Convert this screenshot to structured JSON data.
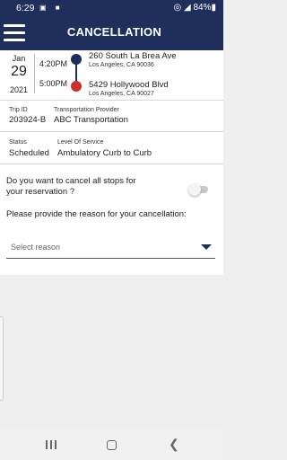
{
  "status_bar": {
    "time": "6:29",
    "notification_icons": "▣ ■",
    "right": "◎ ◢ 84%▮"
  },
  "header": {
    "title": "CANCELLATION"
  },
  "trip": {
    "month": "Jan",
    "day": "29",
    "year": "2021",
    "pickup_time": "4:20PM",
    "dropoff_time": "5:00PM",
    "pickup_address": "260 South La Brea Ave",
    "pickup_city": "Los Angeles, CA 90036",
    "dropoff_address": "5429 Hollywood Blvd",
    "dropoff_city": "Los Angeles, CA 90027"
  },
  "details": {
    "trip_id_label": "Trip ID",
    "trip_id": "203924-B",
    "provider_label": "Transportation Provider",
    "provider": "ABC Transportation",
    "status_label": "Status",
    "status": "Scheduled",
    "service_label": "Level Of Service",
    "service": "Ambulatory Curb to Curb"
  },
  "form": {
    "cancel_all_question": "Do you want to cancel all stops for your reservation ?",
    "cancel_all_value": false,
    "reason_prompt": "Please provide the reason for your cancellation:",
    "reason_placeholder": "Select reason"
  },
  "colors": {
    "brand": "#1f2f5b",
    "dropoff_dot": "#c9302c"
  }
}
